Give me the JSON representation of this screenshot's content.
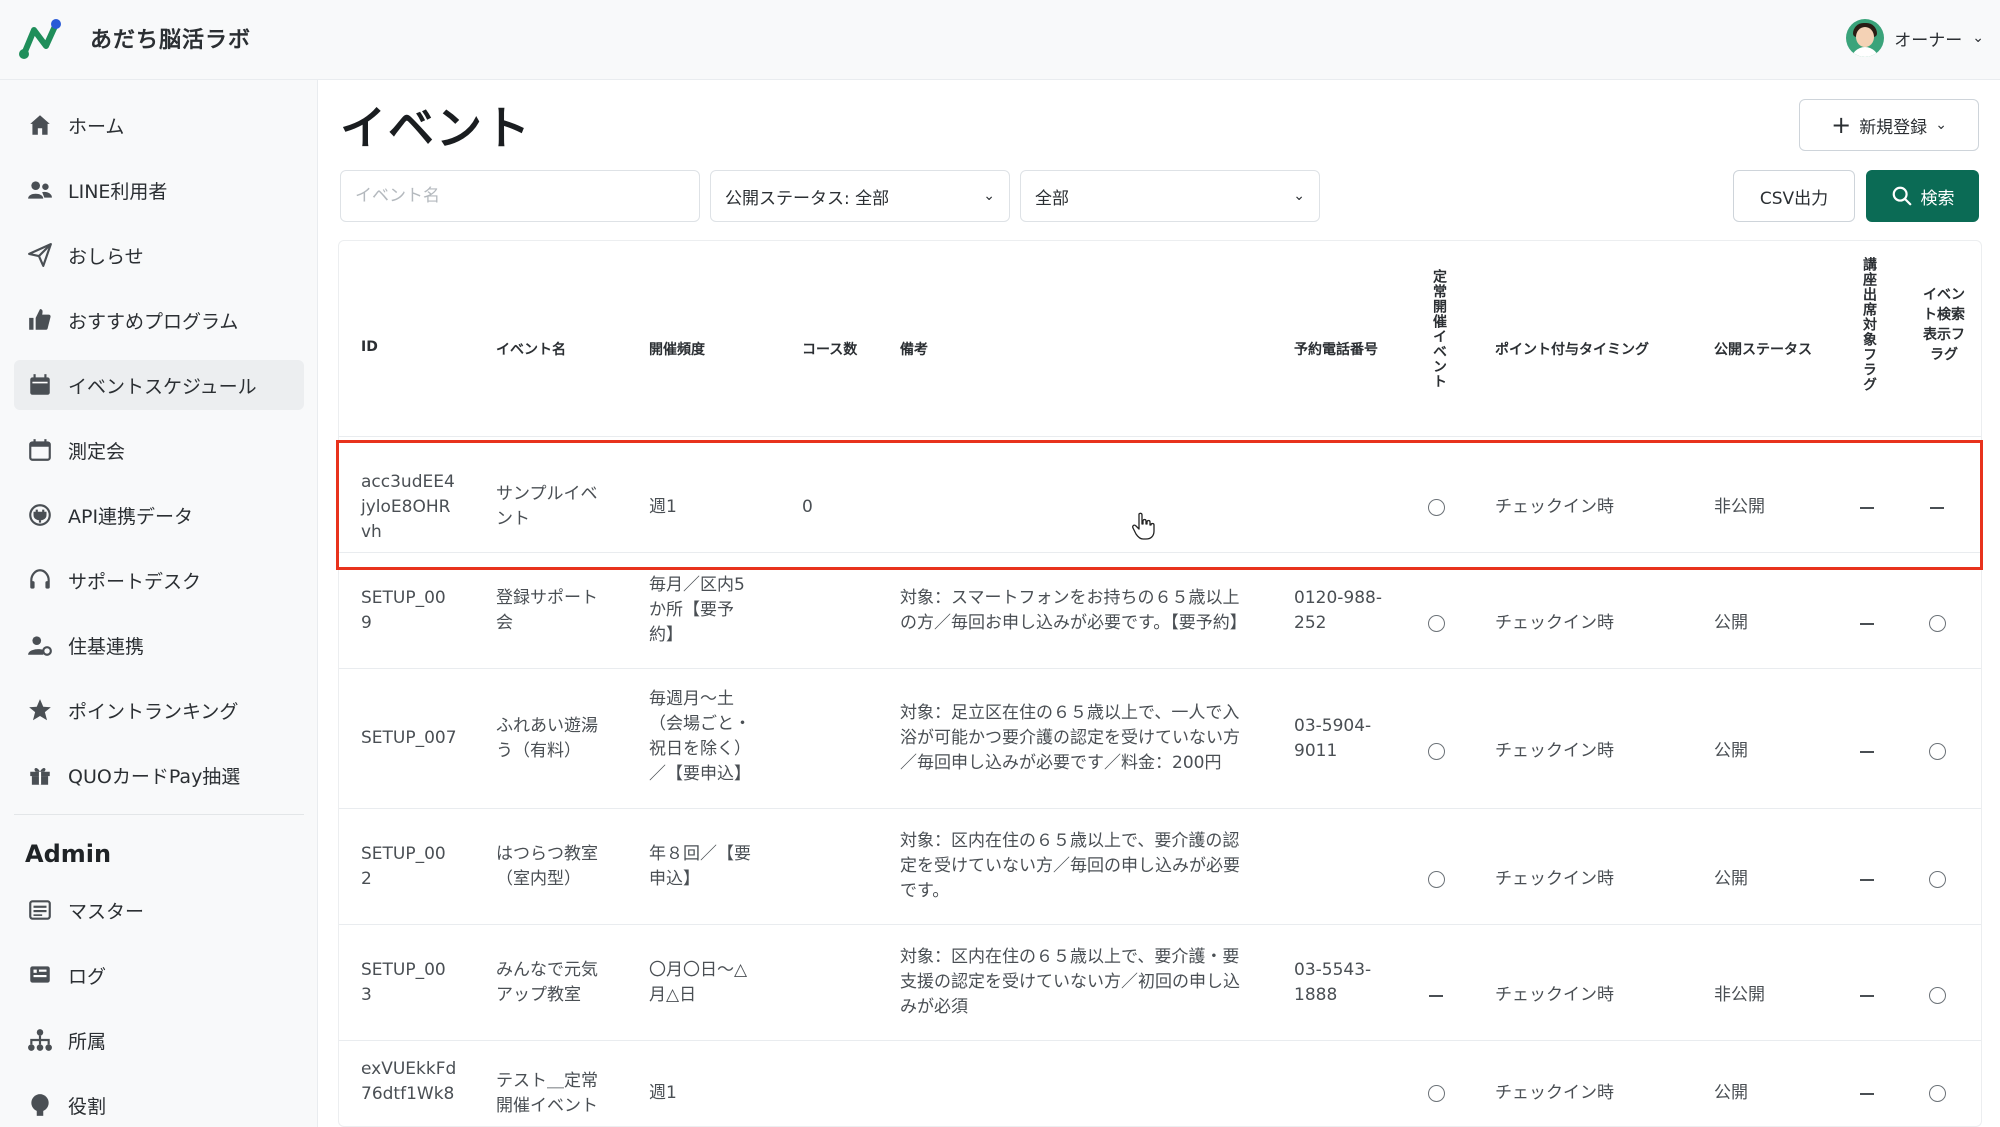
{
  "app": {
    "brand": "あだち脳活ラボ",
    "user_name": "オーナー"
  },
  "sidebar": {
    "items": [
      {
        "label": "ホーム",
        "icon": "home-icon"
      },
      {
        "label": "LINE利用者",
        "icon": "users-icon"
      },
      {
        "label": "おしらせ",
        "icon": "send-icon"
      },
      {
        "label": "おすすめプログラム",
        "icon": "thumbs-up-icon"
      },
      {
        "label": "イベントスケジュール",
        "icon": "calendar-icon"
      },
      {
        "label": "測定会",
        "icon": "calendar-blank-icon"
      },
      {
        "label": "API連携データ",
        "icon": "plug-icon"
      },
      {
        "label": "サポートデスク",
        "icon": "headset-icon"
      },
      {
        "label": "住基連携",
        "icon": "user-cog-icon"
      },
      {
        "label": "ポイントランキング",
        "icon": "star-icon"
      },
      {
        "label": "QUOカードPay抽選",
        "icon": "gift-icon"
      }
    ],
    "admin_heading": "Admin",
    "admin_items": [
      {
        "label": "マスター",
        "icon": "list-icon"
      },
      {
        "label": "ログ",
        "icon": "log-icon"
      },
      {
        "label": "所属",
        "icon": "org-icon"
      },
      {
        "label": "役割",
        "icon": "role-icon"
      }
    ]
  },
  "main": {
    "title": "イベント",
    "new_button": "新規登録",
    "filters": {
      "event_name_placeholder": "イベント名",
      "status_select": "公開ステータス: 全部",
      "category_select": "全部"
    },
    "csv_button": "CSV出力",
    "search_button": "検索"
  },
  "table": {
    "headers": {
      "id": "ID",
      "event_name": "イベント名",
      "frequency": "開催頻度",
      "course_count": "コース数",
      "notes": "備考",
      "phone": "予約電話番号",
      "regular": "定常開催イベント",
      "point_timing": "ポイント付与タイミング",
      "status": "公開ステータス",
      "attendance_flag": "講座出席対象フラグ",
      "search_flag": "イベント検索表示フラグ"
    },
    "rows": [
      {
        "id": [
          "acc3udEE4",
          "jyloE8OHR",
          "vh"
        ],
        "name": [
          "サンプルイベ",
          "ント"
        ],
        "frequency": [
          "週1"
        ],
        "courses": "0",
        "notes": [],
        "phone": [],
        "regular": "radio",
        "timing": "チェックイン時",
        "status": "非公開",
        "attendance": "dash",
        "search": "dash"
      },
      {
        "id": [
          "SETUP_00",
          "9"
        ],
        "name": [
          "登録サポート",
          "会"
        ],
        "frequency": [
          "毎月／区内5",
          "か所【要予",
          "約】"
        ],
        "courses": "",
        "notes": [
          "対象：スマートフォンをお持ちの６５歳以上",
          "の方／毎回お申し込みが必要です。【要予約】"
        ],
        "phone": [
          "0120-988-",
          "252"
        ],
        "regular": "radio",
        "timing": "チェックイン時",
        "status": "公開",
        "attendance": "dash",
        "search": "radio"
      },
      {
        "id": [
          "SETUP_007"
        ],
        "name": [
          "ふれあい遊湯",
          "う（有料）"
        ],
        "frequency": [
          "毎週月～土",
          "（会場ごと・",
          "祝日を除く）",
          "／【要申込】"
        ],
        "courses": "",
        "notes": [
          "対象：足立区在住の６５歳以上で、一人で入",
          "浴が可能かつ要介護の認定を受けていない方",
          "／毎回申し込みが必要です／料金：200円"
        ],
        "phone": [
          "03-5904-",
          "9011"
        ],
        "regular": "radio",
        "timing": "チェックイン時",
        "status": "公開",
        "attendance": "dash",
        "search": "radio"
      },
      {
        "id": [
          "SETUP_00",
          "2"
        ],
        "name": [
          "はつらつ教室",
          "（室内型）"
        ],
        "frequency": [
          "年８回／【要",
          "申込】"
        ],
        "courses": "",
        "notes": [
          "対象：区内在住の６５歳以上で、要介護の認",
          "定を受けていない方／毎回の申し込みが必要",
          "です。"
        ],
        "phone": [],
        "regular": "radio",
        "timing": "チェックイン時",
        "status": "公開",
        "attendance": "dash",
        "search": "radio"
      },
      {
        "id": [
          "SETUP_00",
          "3"
        ],
        "name": [
          "みんなで元気",
          "アップ教室"
        ],
        "frequency": [
          "〇月〇日～△",
          "月△日"
        ],
        "courses": "",
        "notes": [
          "対象：区内在住の６５歳以上で、要介護・要",
          "支援の認定を受けていない方／初回の申し込",
          "みが必須"
        ],
        "phone": [
          "03-5543-",
          "1888"
        ],
        "regular": "dash",
        "timing": "チェックイン時",
        "status": "非公開",
        "attendance": "dash",
        "search": "radio"
      },
      {
        "id": [
          "exVUEkkFd",
          "76dtf1Wk8"
        ],
        "name": [
          "テスト＿定常",
          "開催イベント"
        ],
        "frequency": [
          "週1"
        ],
        "courses": "",
        "notes": [],
        "phone": [],
        "regular": "radio",
        "timing": "チェックイン時",
        "status": "公開",
        "attendance": "dash",
        "search": "radio"
      }
    ]
  }
}
